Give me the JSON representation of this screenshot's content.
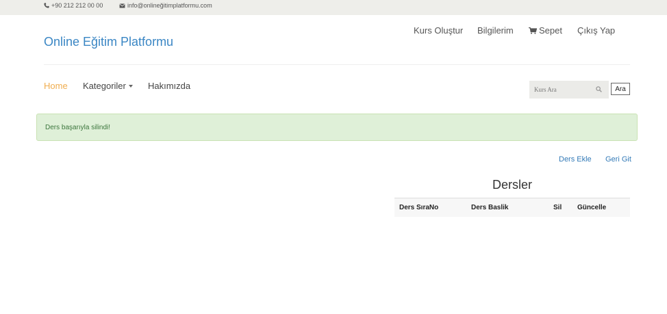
{
  "topbar": {
    "phone": "+90 212 212 00 00",
    "email": "info@onlineğitimplatformu.com"
  },
  "header": {
    "brand": "Online Eğitim Platformu",
    "links": {
      "create_course": "Kurs Oluştur",
      "my_info": "Bilgilerim",
      "cart": "Sepet",
      "logout": "Çıkış Yap"
    }
  },
  "nav": {
    "home": "Home",
    "categories": "Kategoriler",
    "about": "Hakımızda"
  },
  "search": {
    "placeholder": "Kurs Ara",
    "button": "Ara"
  },
  "alert": {
    "message": "Ders başarıyla silindi!"
  },
  "actions": {
    "add_lesson": "Ders Ekle",
    "go_back": "Geri Git"
  },
  "lessons_table": {
    "title": "Dersler",
    "columns": [
      "Ders SıraNo",
      "Ders Baslik",
      "Sil",
      "Güncelle"
    ],
    "rows": []
  },
  "colors": {
    "brand": "#3a86c4",
    "active_nav": "#f0ad4e",
    "link": "#337ab7",
    "alert_bg": "#dff0d8",
    "alert_text": "#3c763d"
  }
}
